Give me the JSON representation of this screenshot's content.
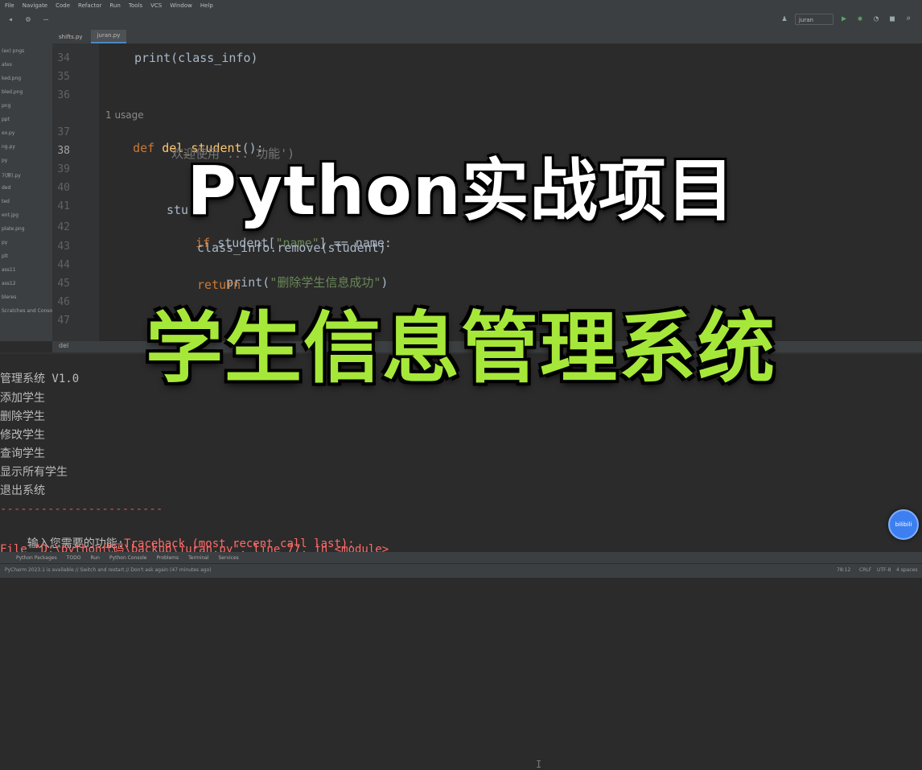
{
  "menu": [
    "File",
    "Navigate",
    "Code",
    "Refactor",
    "Run",
    "Tools",
    "VCS",
    "Window",
    "Help"
  ],
  "toolbar": {
    "run_config": "juran"
  },
  "tabs": [
    {
      "label": "shifts.py",
      "active": false
    },
    {
      "label": "juran.py",
      "active": true
    }
  ],
  "project_tree": [
    "(ex) pngs",
    "ates",
    "ked.png",
    "bled.png",
    "png",
    "ppt",
    "ex.py",
    "ng.py",
    "py",
    "7(原).py",
    "ded",
    "ted",
    "ent.jpg",
    "plate.png",
    "py",
    "plt",
    "ass11",
    "ass12",
    "bleres",
    "Scratches and Consoles"
  ],
  "editor": {
    "line_numbers": [
      "34",
      "35",
      "36",
      "37",
      "38",
      "39",
      "40",
      "41",
      "42",
      "43",
      "44",
      "45",
      "46",
      "47"
    ],
    "current_line": "38",
    "code": {
      "l34": "print(class_info)",
      "usage_hint": "1 usage",
      "l37_kw": "def",
      "l37_fn": "del_student",
      "l37_rest": "():",
      "l38_hint": "欢迎使用 ... 功能')",
      "l41": "stu",
      "l42_kw": "if",
      "l42_a": " student[",
      "l42_str": "\"name\"",
      "l42_b": "] == name:",
      "l43": "class_info.remove(student)",
      "l44_a": "print(",
      "l44_str": "\"删除学生信息成功\"",
      "l44_b": ")",
      "l45_kw": "return"
    },
    "breadcrumb": "del"
  },
  "console": {
    "lines": [
      "管理系统 V1.0",
      "添加学生",
      "删除学生",
      "修改学生",
      "查询学生",
      "显示所有学生",
      "退出系统"
    ],
    "separator": "------------------------",
    "prompt": "输入您需要的功能:",
    "traceback": "Traceback (most recent call last):",
    "file_line": "File \"D:\\python代码\\backup\\juran.py\", line 77, in <module>"
  },
  "bottom_tools": [
    "Python Packages",
    "TODO",
    "Run",
    "Python Console",
    "Problems",
    "Terminal",
    "Services"
  ],
  "status": {
    "left": "PyCharm 2023.1 is available // Switch and restart // Don't ask again (47 minutes ago)",
    "right": [
      "78:12",
      "CRLF",
      "UTF-8",
      "4 spaces"
    ]
  },
  "overlay": {
    "title": "Python实战项目",
    "subtitle": "学生信息管理系统"
  },
  "floating_button": {
    "label": "bilibili"
  },
  "colors": {
    "title": "#ffffff",
    "subtitle": "#a6e83a",
    "editor_bg": "#2b2b2b",
    "keyword": "#cc7832",
    "function": "#ffc66d",
    "string": "#6a8759",
    "error": "#ff6b68"
  }
}
